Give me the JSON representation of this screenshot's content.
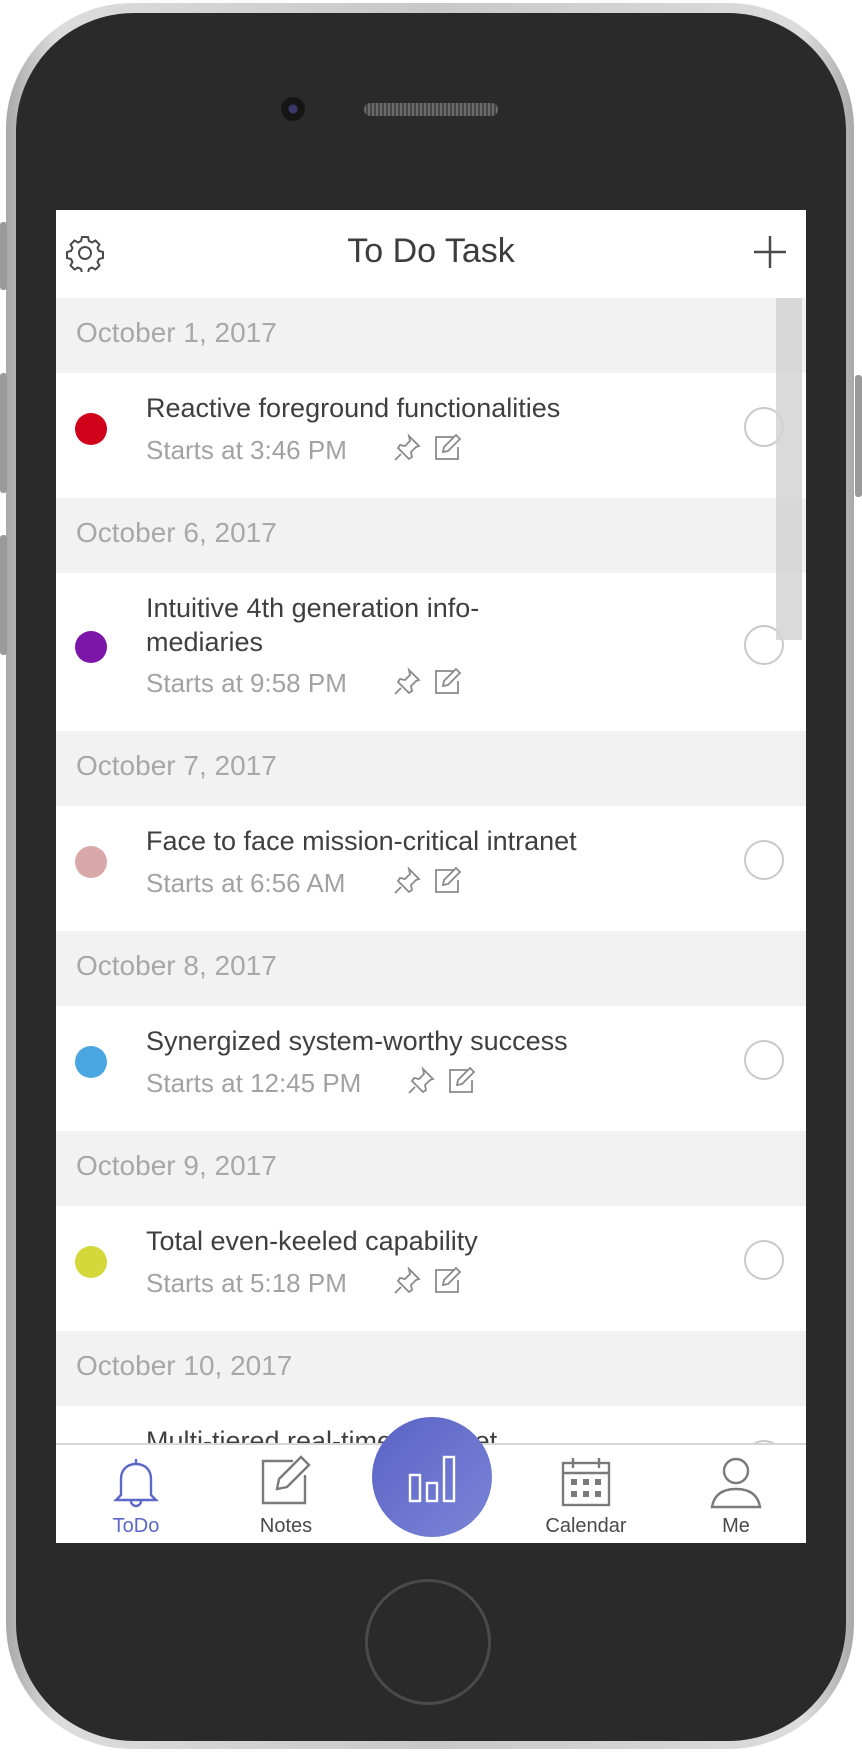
{
  "app": {
    "title": "To Do Task"
  },
  "header": {
    "settings_icon": "gear-icon",
    "add_icon": "plus-icon"
  },
  "colors": {
    "accent": "#5c67c7",
    "date_bg": "#f2f2f2",
    "text": "#3f3f3f",
    "muted": "#a2a2a2"
  },
  "groups": [
    {
      "date": "October 1, 2017",
      "task": {
        "title": "Reactive foreground functionalities",
        "time": "Starts at 3:46 PM",
        "color": "#d0021b"
      }
    },
    {
      "date": "October 6, 2017",
      "task": {
        "title": "Intuitive 4th generation info-mediaries",
        "time": "Starts at 9:58 PM",
        "color": "#7b16a8"
      }
    },
    {
      "date": "October 7, 2017",
      "task": {
        "title": "Face to face mission-critical intranet",
        "time": "Starts at 6:56 AM",
        "color": "#d9a8a8"
      }
    },
    {
      "date": "October 8, 2017",
      "task": {
        "title": "Synergized system-worthy success",
        "time": "Starts at 12:45 PM",
        "color": "#4aa6e0"
      }
    },
    {
      "date": "October 9, 2017",
      "task": {
        "title": "Total even-keeled capability",
        "time": "Starts at 5:18 PM",
        "color": "#d4d83a"
      }
    },
    {
      "date": "October 10, 2017",
      "task": {
        "title": "Multi-tiered real-time extranet"
      }
    }
  ],
  "tabs": [
    {
      "label": "ToDo",
      "icon": "bell-icon",
      "active": true
    },
    {
      "label": "Notes",
      "icon": "note-edit-icon"
    },
    {
      "label": "",
      "icon": "bar-chart-icon"
    },
    {
      "label": "Calendar",
      "icon": "calendar-icon"
    },
    {
      "label": "Me",
      "icon": "person-icon"
    }
  ]
}
